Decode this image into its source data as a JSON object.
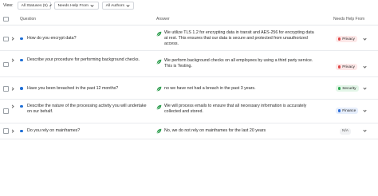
{
  "toolbar": {
    "view_label": "View:",
    "filters": [
      {
        "label": "All Statuses (5)"
      },
      {
        "label": "Needs Help From"
      },
      {
        "label": "All Authors"
      }
    ]
  },
  "table": {
    "headers": {
      "question": "Question",
      "answer": "Answer",
      "needs_help_from": "Needs Help From"
    },
    "rows": [
      {
        "question": "How do you encrypt data?",
        "answer": "We utilize TLS 1.2 for encrypting data in transit and AES-256 for encrypting data at rest. This ensures that our data is secure and protected from unauthorized access.",
        "tag": "Privacy",
        "tag_bg": "#fde8e8",
        "tag_dot": "#e04848"
      },
      {
        "question": "Describe your procedure for performing background checks.",
        "answer": "We perform background checks on all employees by using a third party service. This is Testing.",
        "tag": "Privacy",
        "tag_bg": "#fde8e8",
        "tag_dot": "#e04848"
      },
      {
        "question": "Have you been breached in the past 12 months?",
        "answer": "no we have not had a breach in the past 3 years.",
        "tag": "Security",
        "tag_bg": "#e3f6e8",
        "tag_dot": "#2eaa52"
      },
      {
        "question": "Describe the nature of the processing activity you will undertake on our behalf.",
        "answer": "We will process emails to ensure that all necessary information is accurately collected and stored.",
        "tag": "Finance",
        "tag_bg": "#e6eefc",
        "tag_dot": "#2f6fd8"
      },
      {
        "question": "Do you rely on mainframes?",
        "answer": "No, we do not rely on mainframes for the last 20 years",
        "tag": "N/A",
        "tag_bg": "#f1f2f4",
        "tag_dot": ""
      }
    ]
  },
  "colors": {
    "status_dot": "#1f6fd6",
    "approved_leaf": "#2e9e4f"
  }
}
